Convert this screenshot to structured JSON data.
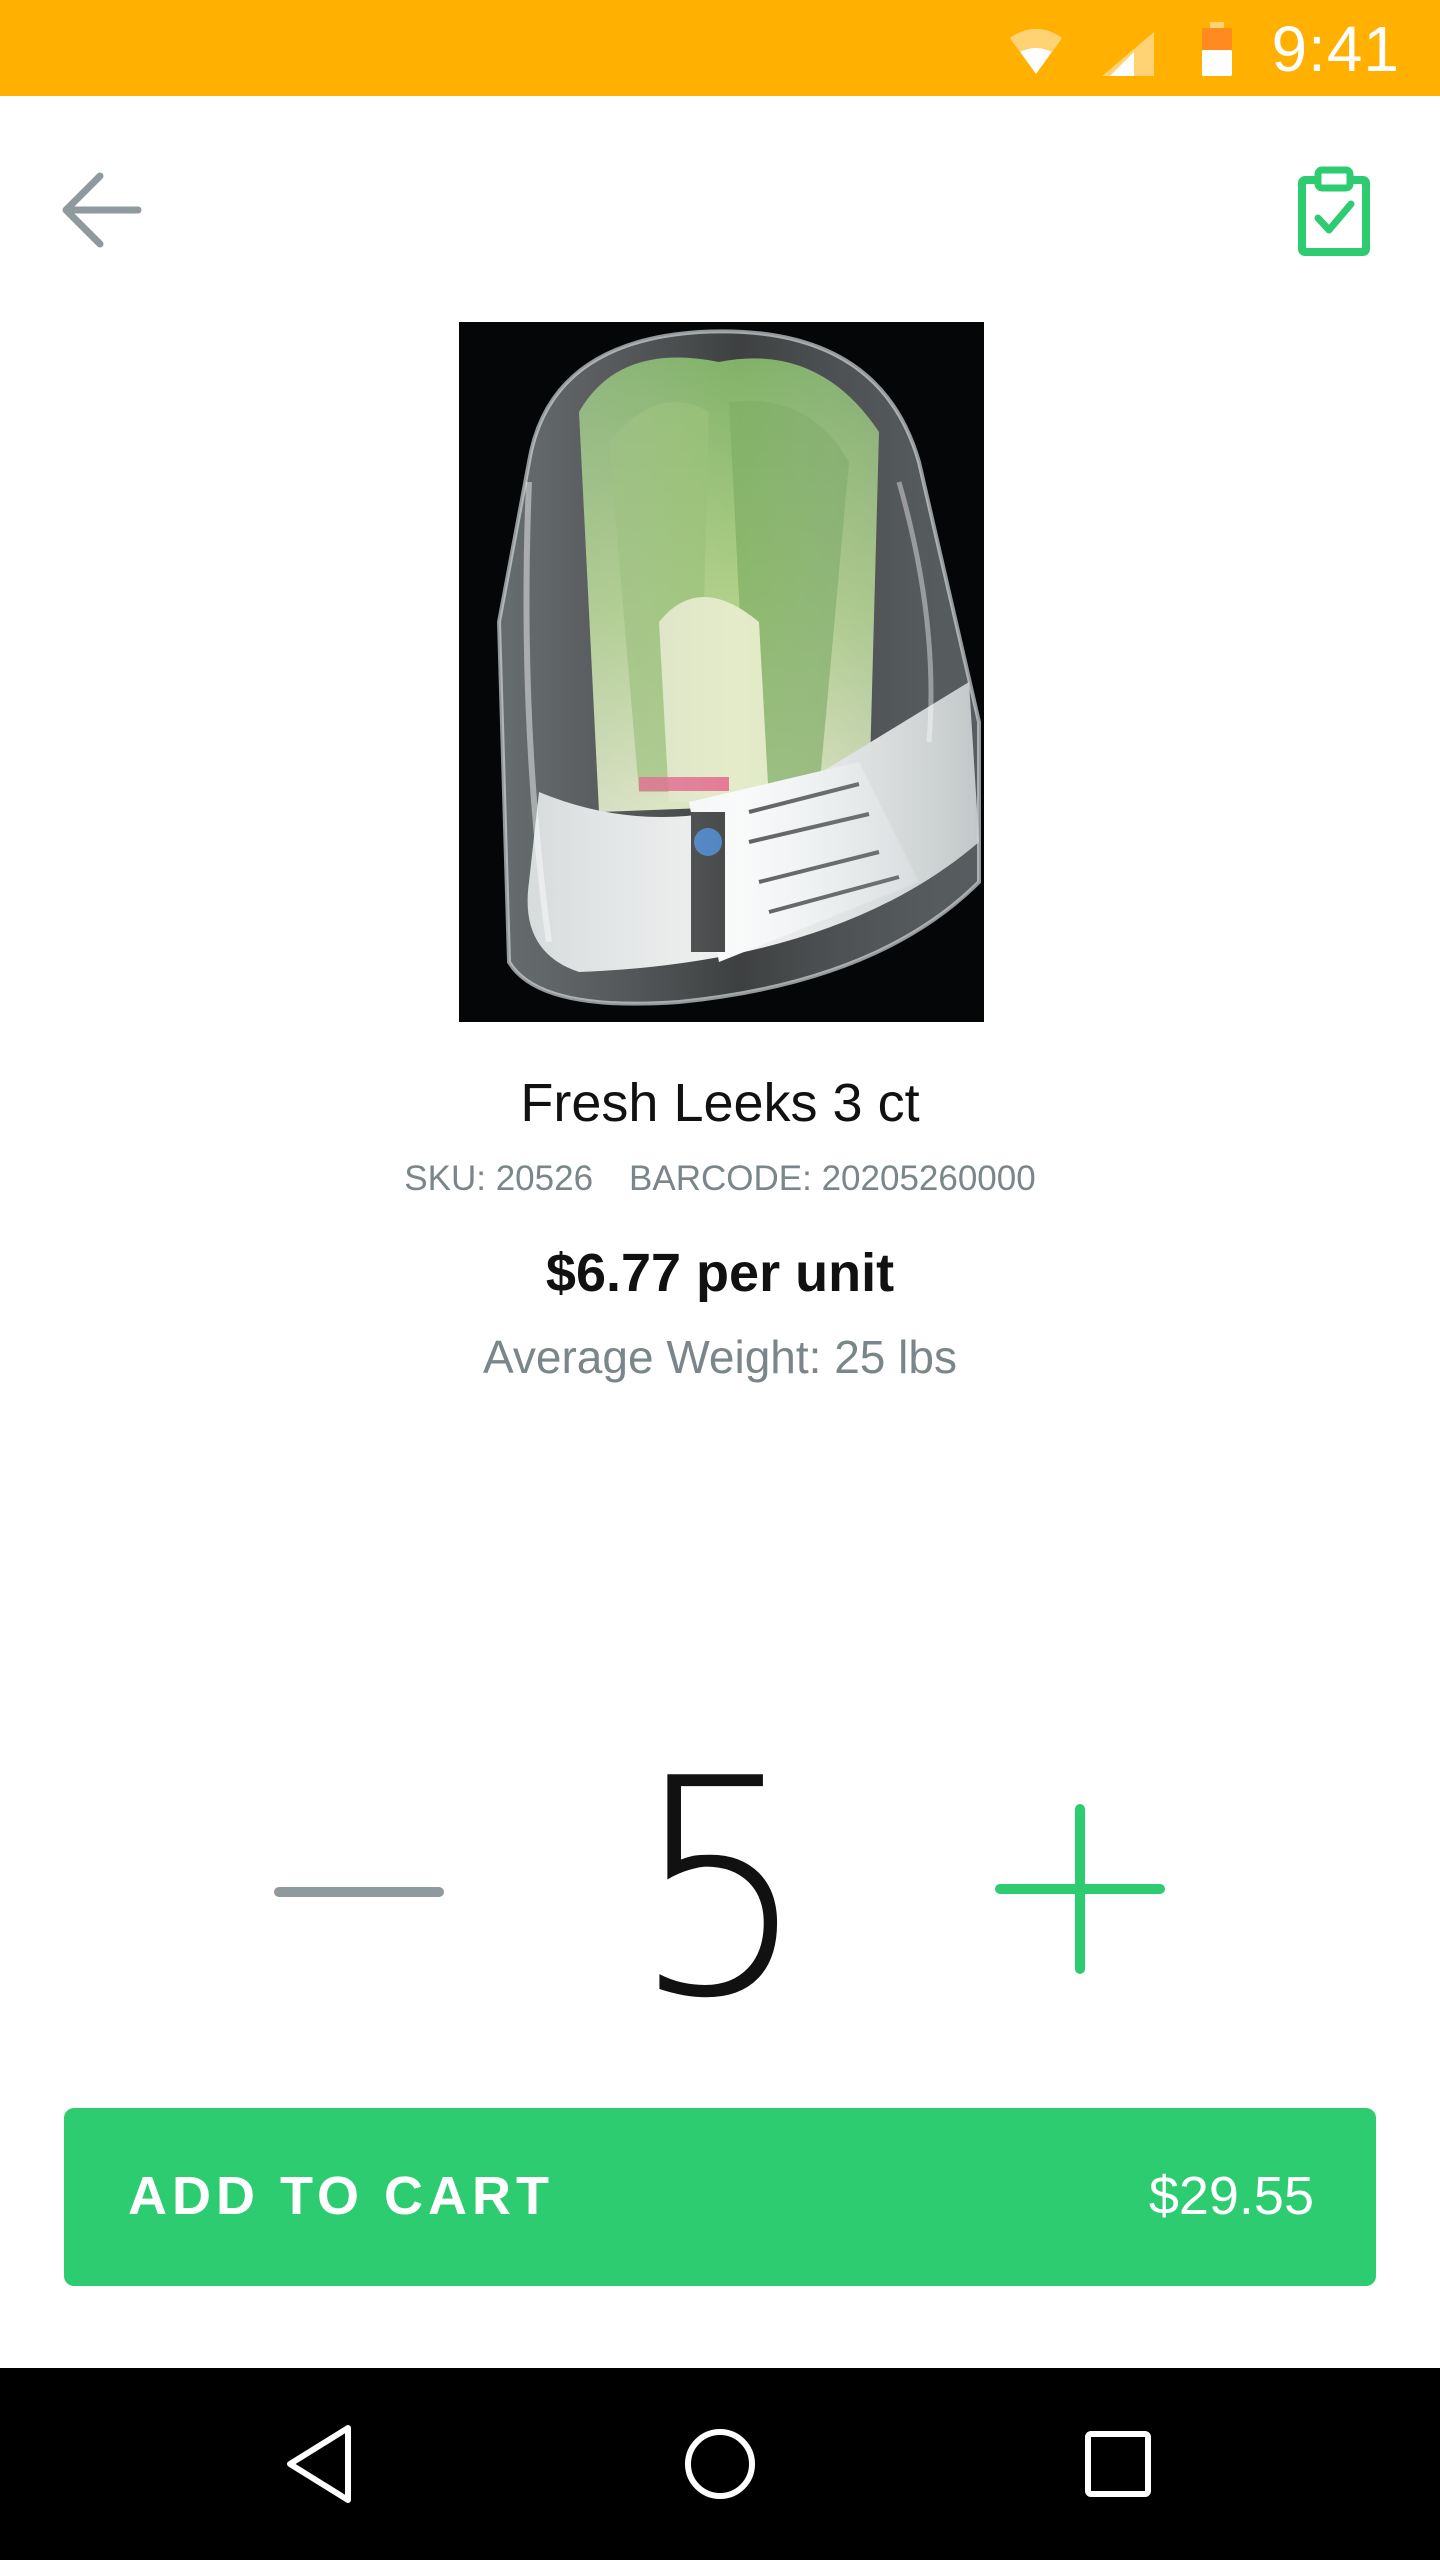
{
  "status_bar": {
    "time": "9:41",
    "color": "#FFB000",
    "icons": [
      "wifi-icon",
      "cell-signal-icon",
      "battery-icon"
    ]
  },
  "app_bar": {
    "back_icon": "arrow-left-icon",
    "action_icon": "clipboard-check-icon"
  },
  "product": {
    "image": "leeks-in-plastic-bag",
    "name": "Fresh Leeks 3 ct",
    "sku": "SKU: 20526",
    "barcode": "BARCODE: 20205260000",
    "price": "$6.77 per unit",
    "average_weight": "Average Weight: 25 lbs"
  },
  "stepper": {
    "quantity": "5",
    "minus_icon": "minus-icon",
    "plus_icon": "plus-icon"
  },
  "cart_button": {
    "label": "ADD TO CART",
    "total": "$29.55",
    "color": "#2ECC71"
  },
  "nav_bar": {
    "icons": [
      "nav-back-icon",
      "nav-home-icon",
      "nav-recents-icon"
    ]
  }
}
